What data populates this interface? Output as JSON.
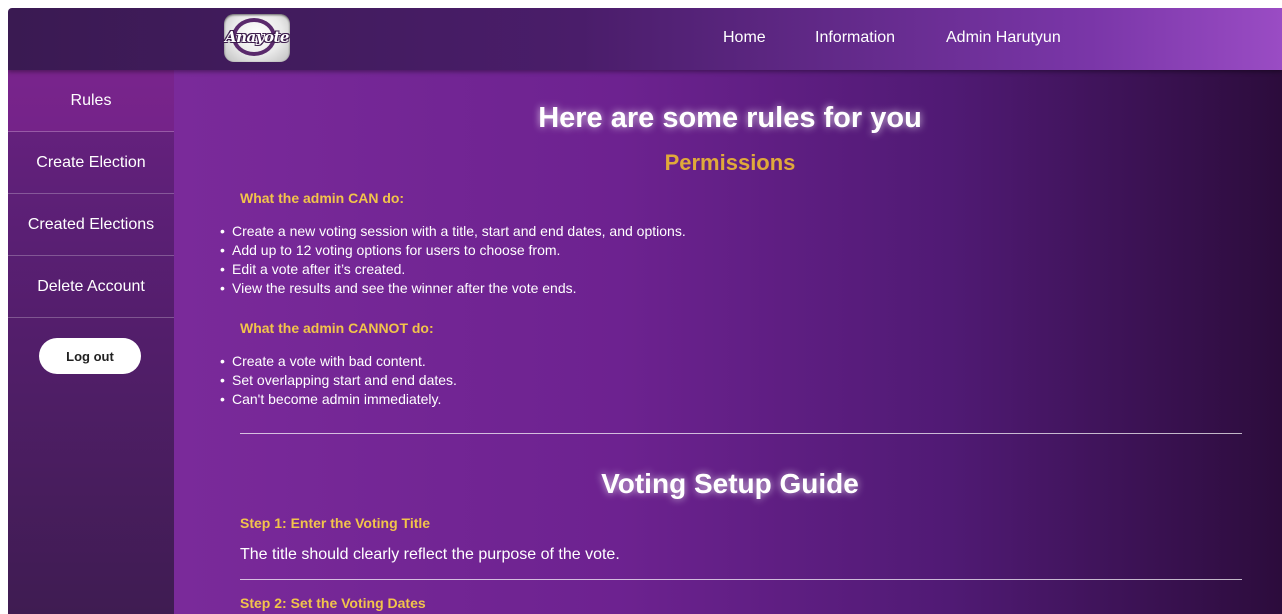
{
  "header": {
    "logo_text": "Anayote",
    "nav": [
      {
        "label": "Home"
      },
      {
        "label": "Information"
      },
      {
        "label": "Admin Harutyun"
      }
    ]
  },
  "sidebar": {
    "items": [
      {
        "label": "Rules"
      },
      {
        "label": "Create Election"
      },
      {
        "label": "Created Elections"
      },
      {
        "label": "Delete Account"
      }
    ],
    "logout_label": "Log out"
  },
  "main": {
    "title": "Here are some rules for you",
    "permissions_title": "Permissions",
    "can_title": "What the admin CAN do:",
    "can_items": [
      "Create a new voting session with a title, start and end dates, and options.",
      "Add up to 12 voting options for users to choose from.",
      "Edit a vote after it’s created.",
      "View the results and see the winner after the vote ends."
    ],
    "cannot_title": "What the admin CANNOT do:",
    "cannot_items": [
      "Create a vote with bad content.",
      "Set overlapping start and end dates.",
      "Can't become admin immediately."
    ],
    "guide_title": "Voting Setup Guide",
    "step1_title": "Step 1: Enter the Voting Title",
    "step1_text": "The title should clearly reflect the purpose of the vote.",
    "step2_title": "Step 2: Set the Voting Dates"
  },
  "colors": {
    "accent_gold": "#e0a93a",
    "accent_yellow": "#f2c44a",
    "header_start": "#3a1a52",
    "header_end": "#9a4cc4"
  }
}
